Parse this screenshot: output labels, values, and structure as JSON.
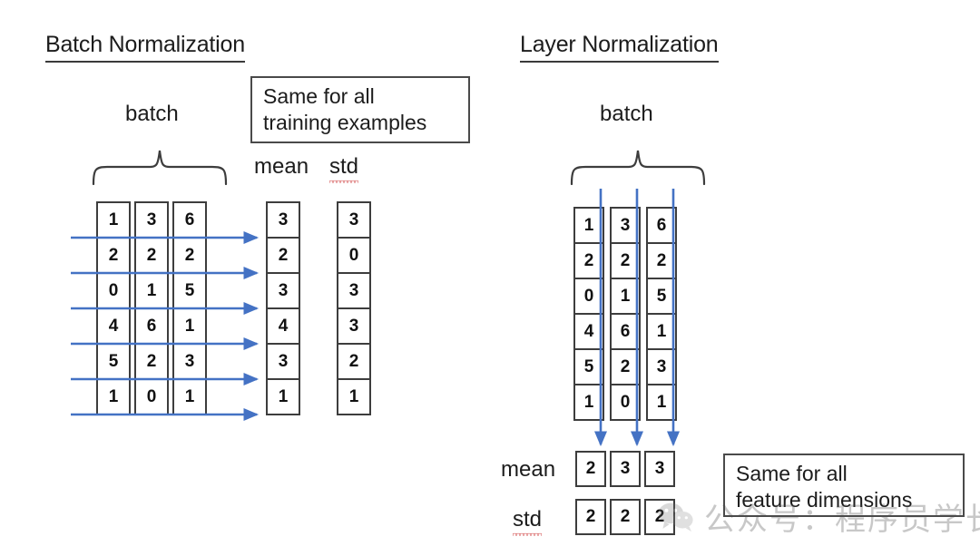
{
  "page": {
    "background": "#ffffff",
    "accent_blue": "#4472c4",
    "outline": "#3d3d3d"
  },
  "left_panel": {
    "title": "Batch Normalization",
    "batch_label": "batch",
    "callout": "Same for all\ntraining examples",
    "mean_label": "mean",
    "std_label": "std",
    "matrix": {
      "rows": 6,
      "cols": 3,
      "values": [
        [
          "1",
          "3",
          "6"
        ],
        [
          "2",
          "2",
          "2"
        ],
        [
          "0",
          "1",
          "5"
        ],
        [
          "4",
          "6",
          "1"
        ],
        [
          "5",
          "2",
          "3"
        ],
        [
          "1",
          "0",
          "1"
        ]
      ]
    },
    "mean_values": [
      "3",
      "2",
      "3",
      "4",
      "3",
      "1"
    ],
    "std_values": [
      "3",
      "0",
      "3",
      "3",
      "2",
      "1"
    ],
    "arrow_direction": "right",
    "arrow_count": 6
  },
  "right_panel": {
    "title": "Layer Normalization",
    "batch_label": "batch",
    "callout": "Same for all\nfeature dimensions",
    "mean_label": "mean",
    "std_label": "std",
    "matrix": {
      "rows": 6,
      "cols": 3,
      "values": [
        [
          "1",
          "3",
          "6"
        ],
        [
          "2",
          "2",
          "2"
        ],
        [
          "0",
          "1",
          "5"
        ],
        [
          "4",
          "6",
          "1"
        ],
        [
          "5",
          "2",
          "3"
        ],
        [
          "1",
          "0",
          "1"
        ]
      ]
    },
    "mean_values": [
      "2",
      "3",
      "3"
    ],
    "std_values": [
      "2",
      "2",
      "2"
    ],
    "arrow_direction": "down",
    "arrow_count": 3
  },
  "watermark": {
    "text": "公众号：程序员学长",
    "logo": "wechat-logo-icon"
  }
}
